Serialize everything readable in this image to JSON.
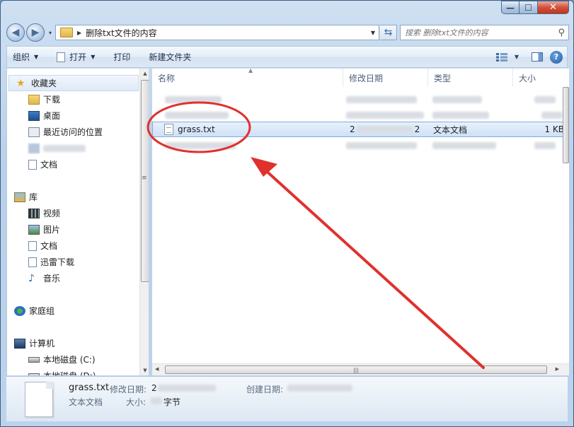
{
  "window": {
    "caption": {
      "minimize": "—",
      "maximize": "☐",
      "close": "✕"
    }
  },
  "navigation": {
    "back_icon": "◀",
    "forward_icon": "▶",
    "recent_icon": "▾",
    "address_path": "删除txt文件的内容",
    "refresh_icon": "⇆",
    "search_placeholder": "搜索 删除txt文件的内容",
    "search_icon": "⚲"
  },
  "toolbar": {
    "organize": "组织",
    "open": "打开",
    "print": "打印",
    "new_folder": "新建文件夹",
    "help": "?"
  },
  "sidebar": {
    "favorites": {
      "header": "收藏夹",
      "items": [
        "下载",
        "桌面",
        "最近访问的位置",
        "",
        "文档"
      ]
    },
    "libraries": {
      "header": "库",
      "items": [
        "视频",
        "图片",
        "文档",
        "迅雷下载",
        "音乐"
      ]
    },
    "homegroup": "家庭组",
    "computer": {
      "header": "计算机",
      "items": [
        "本地磁盘 (C:)",
        "本地磁盘 (D:)"
      ]
    }
  },
  "file_list": {
    "columns": [
      "名称",
      "修改日期",
      "类型",
      "大小"
    ],
    "selected_file": {
      "name": "grass.txt",
      "date_prefix": "2",
      "date_suffix": "2",
      "type": "文本文档",
      "size": "1 KB"
    }
  },
  "details_pane": {
    "name": "grass.txt",
    "type": "文本文档",
    "modified_label": "修改日期:",
    "modified_value_prefix": "2",
    "size_label": "大小:",
    "size_unit": "字节",
    "created_label": "创建日期:"
  },
  "colors": {
    "annotation_red": "#e0312d",
    "selection": "#cde1f7",
    "accent": "#3f5e83"
  }
}
